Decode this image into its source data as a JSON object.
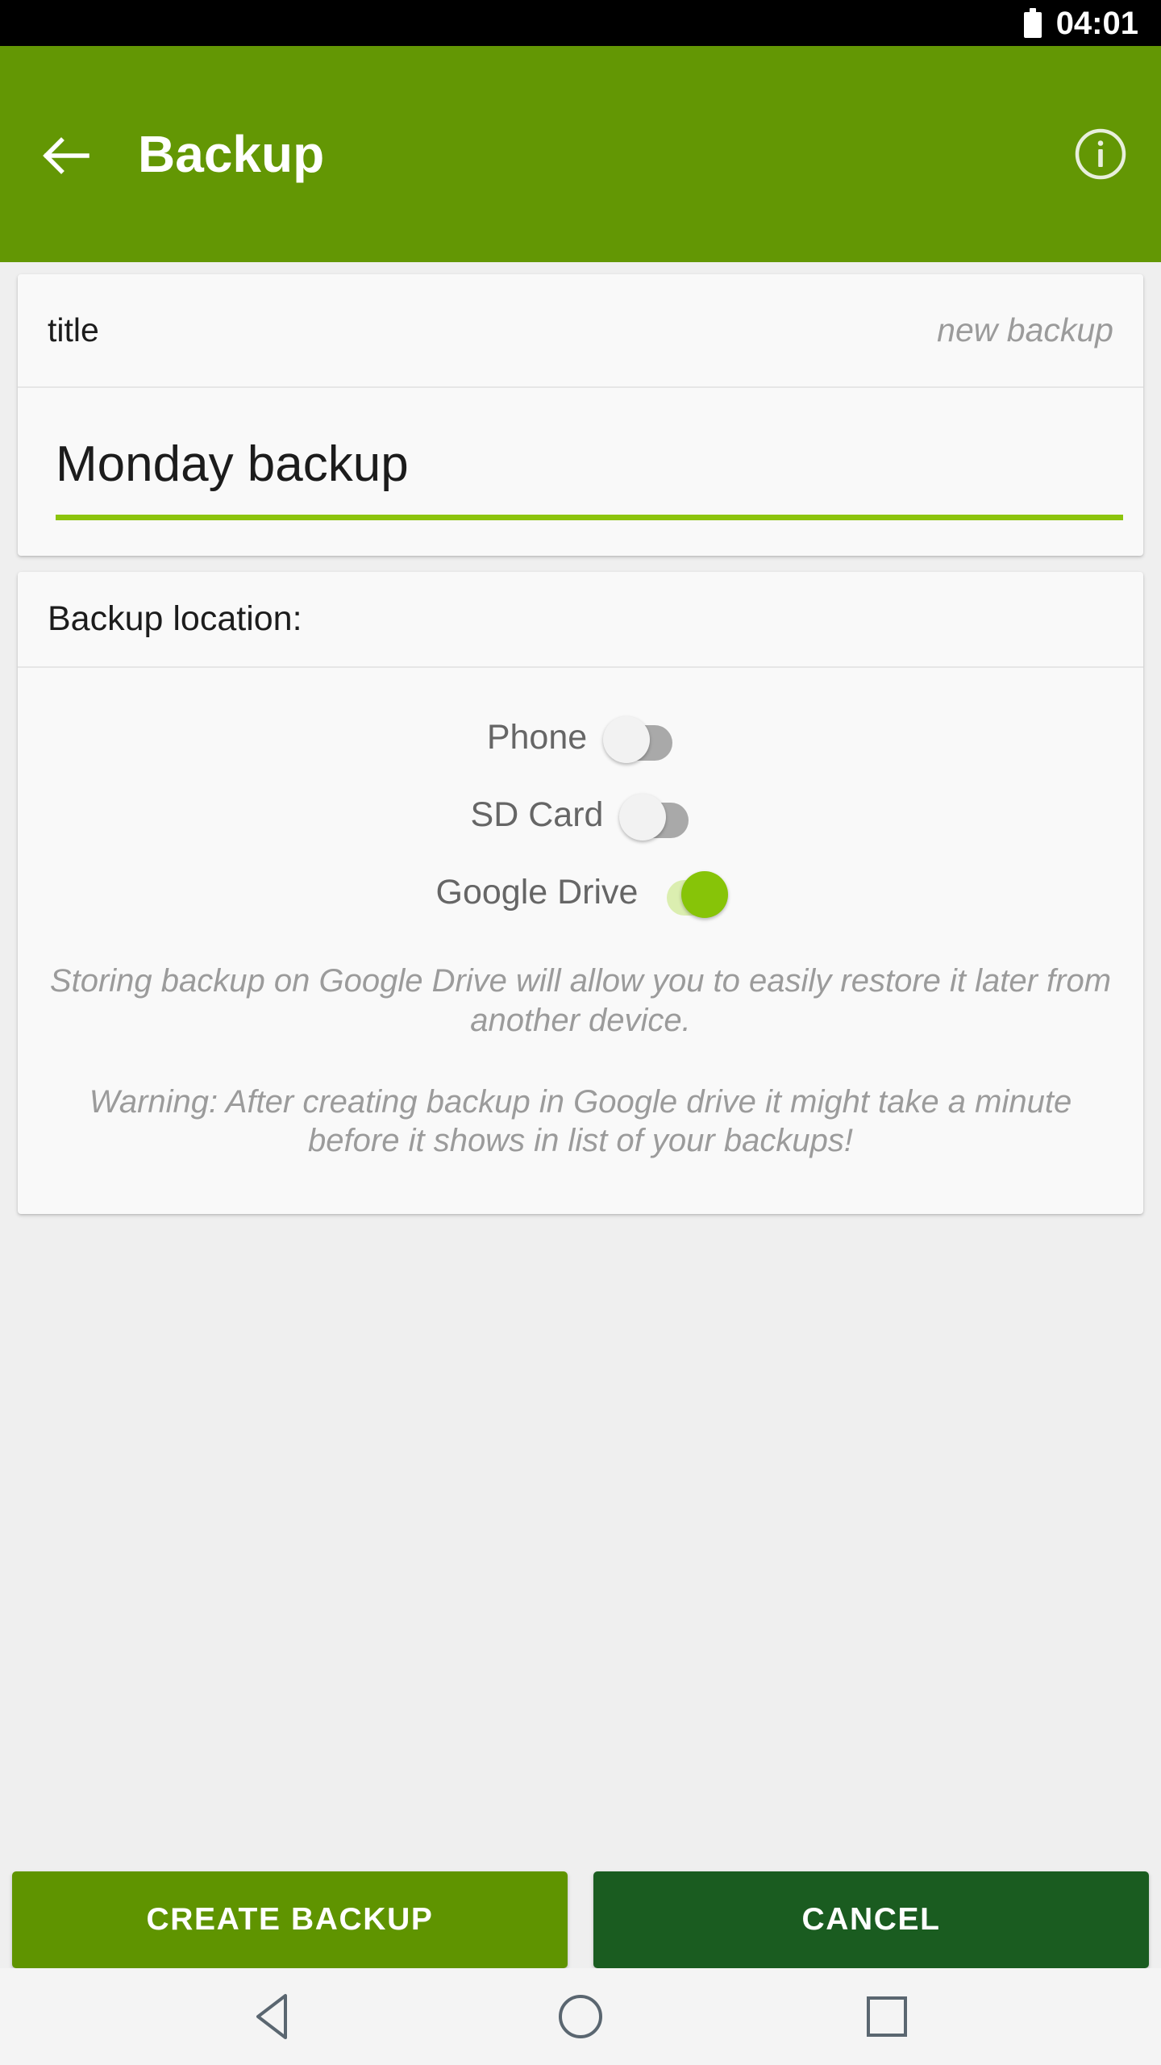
{
  "status_bar": {
    "time": "04:01",
    "battery_icon": "battery-full-icon"
  },
  "app_bar": {
    "title": "Backup",
    "back_icon": "back-arrow-icon",
    "info_icon": "info-icon",
    "background_color": "#639704"
  },
  "title_card": {
    "label": "title",
    "hint": "new backup",
    "input_value": "Monday backup",
    "underline_color": "#8cc40d"
  },
  "location_card": {
    "header": "Backup location:",
    "toggles": [
      {
        "label": "Phone",
        "on": false
      },
      {
        "label": "SD Card",
        "on": false
      },
      {
        "label": "Google Drive",
        "on": true
      }
    ],
    "notes": [
      "Storing backup on Google Drive will allow you to easily restore it later from another device.",
      "Warning: After creating backup in Google drive it might take a minute before it shows in list of your backups!"
    ]
  },
  "buttons": {
    "create_label": "CREATE BACKUP",
    "cancel_label": "CANCEL",
    "create_color": "#5f9400",
    "cancel_color": "#1a5c20"
  },
  "nav_bar": {
    "back_icon": "nav-back-triangle-icon",
    "home_icon": "nav-home-circle-icon",
    "recents_icon": "nav-recents-square-icon"
  }
}
